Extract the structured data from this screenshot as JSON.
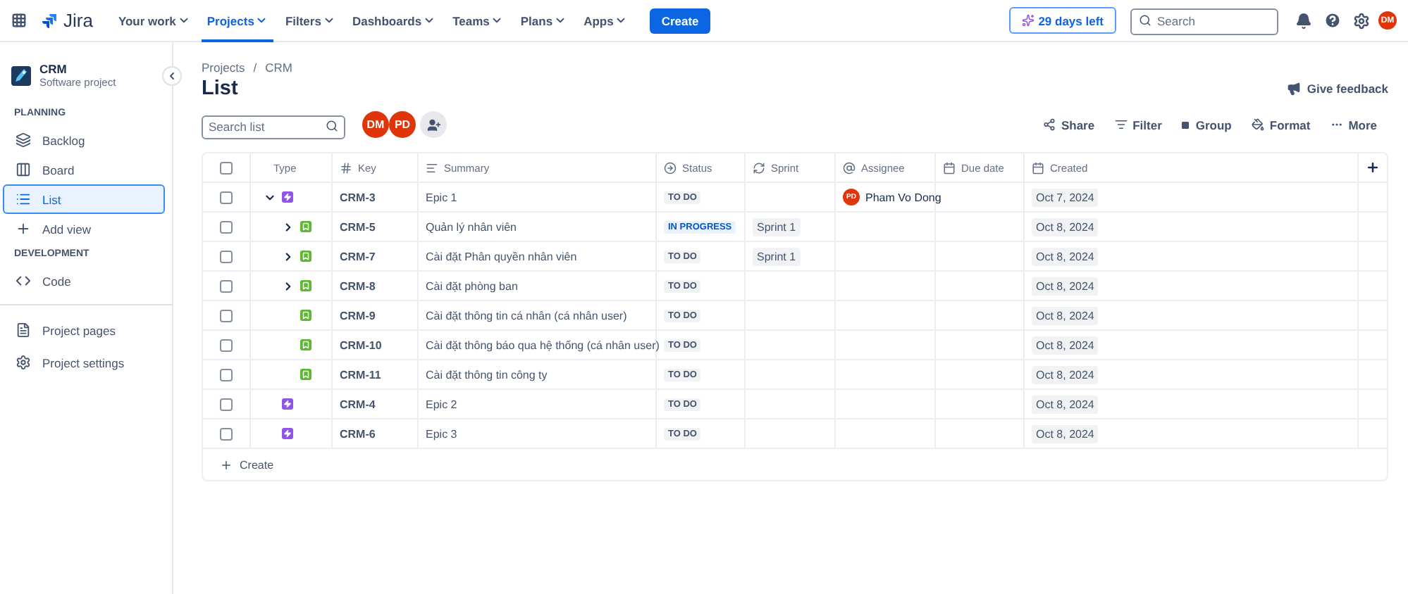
{
  "topnav": {
    "product": "Jira",
    "items": [
      {
        "label": "Your work",
        "selected": false
      },
      {
        "label": "Projects",
        "selected": true
      },
      {
        "label": "Filters",
        "selected": false
      },
      {
        "label": "Dashboards",
        "selected": false
      },
      {
        "label": "Teams",
        "selected": false
      },
      {
        "label": "Plans",
        "selected": false
      },
      {
        "label": "Apps",
        "selected": false
      }
    ],
    "create": "Create",
    "trial": "29 days left",
    "search": {
      "placeholder": "Search"
    },
    "avatar": "DM"
  },
  "sidebar": {
    "project": {
      "name": "CRM",
      "type": "Software project"
    },
    "sections": [
      {
        "title": "PLANNING",
        "items": [
          {
            "label": "Backlog",
            "selected": false
          },
          {
            "label": "Board",
            "selected": false
          },
          {
            "label": "List",
            "selected": true
          },
          {
            "label": "Add view",
            "selected": false
          }
        ]
      },
      {
        "title": "DEVELOPMENT",
        "items": [
          {
            "label": "Code",
            "selected": false
          }
        ]
      }
    ],
    "footer": [
      {
        "label": "Project pages"
      },
      {
        "label": "Project settings"
      }
    ]
  },
  "breadcrumbs": {
    "items": [
      "Projects",
      "CRM"
    ],
    "separator": "/"
  },
  "title": "List",
  "feedback": "Give feedback",
  "search": {
    "placeholder": "Search list"
  },
  "avatars": [
    "DM",
    "PD"
  ],
  "actions": [
    "Share",
    "Filter",
    "Group",
    "Format",
    "More"
  ],
  "table": {
    "select_all": {
      "checked": false
    },
    "columns": [
      "Type",
      "Key",
      "Summary",
      "Status",
      "Sprint",
      "Assignee",
      "Due date",
      "Created"
    ],
    "rows": [
      {
        "kind": "epic",
        "key": "CRM-3",
        "summary": "Epic 1",
        "status": {
          "label": "TO DO",
          "kind": "todo"
        },
        "assignee": {
          "initials": "PD",
          "name": "Pham Vo Dong"
        },
        "created": "Oct 7, 2024",
        "checked": false,
        "expanded": true,
        "children": [
          {
            "kind": "story",
            "key": "CRM-5",
            "summary": "Quản lý nhân viên",
            "status": {
              "label": "IN PROGRESS",
              "kind": "progress"
            },
            "sprint": "Sprint 1",
            "created": "Oct 8, 2024",
            "checked": false,
            "expanded": false
          },
          {
            "kind": "story",
            "key": "CRM-7",
            "summary": "Cài đặt Phân quyền nhân viên",
            "status": {
              "label": "TO DO",
              "kind": "todo"
            },
            "sprint": "Sprint 1",
            "created": "Oct 8, 2024",
            "checked": false,
            "expanded": false
          },
          {
            "kind": "story",
            "key": "CRM-8",
            "summary": "Cài đặt phòng ban",
            "status": {
              "label": "TO DO",
              "kind": "todo"
            },
            "created": "Oct 8, 2024",
            "checked": false,
            "expanded": false
          },
          {
            "kind": "story",
            "key": "CRM-9",
            "summary": "Cài đặt thông tin cá nhân (cá nhân user)",
            "status": {
              "label": "TO DO",
              "kind": "todo"
            },
            "created": "Oct 8, 2024",
            "checked": false
          },
          {
            "kind": "story",
            "key": "CRM-10",
            "summary": "Cài đặt thông báo qua hệ thống (cá nhân user)",
            "status": {
              "label": "TO DO",
              "kind": "todo"
            },
            "created": "Oct 8, 2024",
            "checked": false
          },
          {
            "kind": "story",
            "key": "CRM-11",
            "summary": "Cài đặt thông tin công ty",
            "status": {
              "label": "TO DO",
              "kind": "todo"
            },
            "created": "Oct 8, 2024",
            "checked": false
          }
        ]
      },
      {
        "kind": "epic",
        "key": "CRM-4",
        "summary": "Epic 2",
        "status": {
          "label": "TO DO",
          "kind": "todo"
        },
        "created": "Oct 8, 2024",
        "checked": false
      },
      {
        "kind": "epic",
        "key": "CRM-6",
        "summary": "Epic 3",
        "status": {
          "label": "TO DO",
          "kind": "todo"
        },
        "created": "Oct 8, 2024",
        "checked": false
      }
    ],
    "create": "Create"
  }
}
